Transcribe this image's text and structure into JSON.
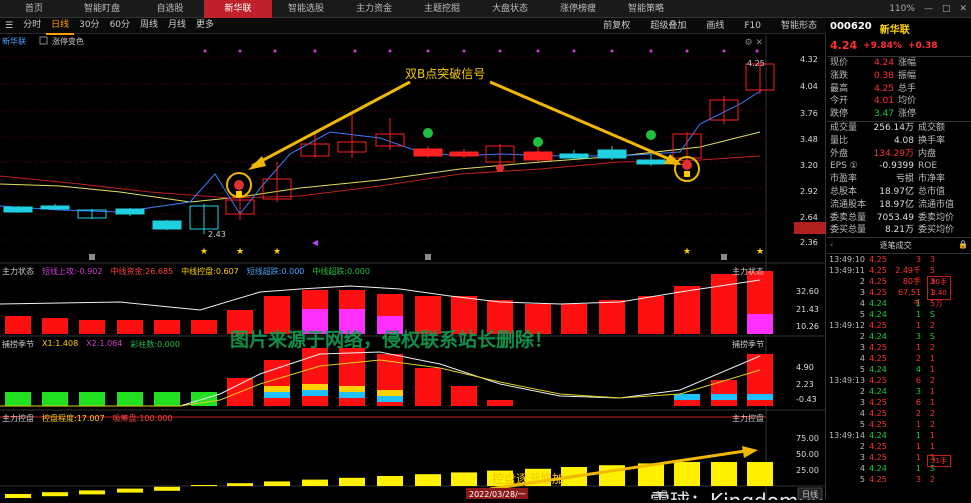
{
  "top_tabs": [
    "首页",
    "智能盯盘",
    "自选股",
    "新华联",
    "智能选股",
    "主力资金",
    "主题挖掘",
    "大盘状态",
    "涨停榜瘦",
    "智能策略"
  ],
  "active_tab": 3,
  "sys": {
    "signal": "",
    "battery": "110%",
    "minus": "—",
    "box": "□",
    "close": "✕"
  },
  "toolbar": {
    "left": [
      "分时",
      "日线",
      "30分",
      "60分",
      "周线",
      "月线",
      "更多"
    ],
    "active": 1,
    "right": [
      "前复权",
      "超级叠加",
      "画线",
      "F10",
      "智能形态"
    ]
  },
  "chart": {
    "stock_label": "新华联",
    "indicator_label": "涨停变色",
    "price_ticks": [
      "4.32",
      "4.04",
      "3.76",
      "3.48",
      "3.20",
      "2.92",
      "2.64",
      "2.51",
      "2.36"
    ],
    "high_label": "4.25",
    "low_label": "2.43",
    "annotation_top": "双B点突破信号",
    "panel1": {
      "name": "主力状态",
      "items": [
        "短线上攻:-0.902",
        "中线资金:26.685",
        "中线控盘:0.607",
        "短线超跌:0.000",
        "中线超跌:0.000"
      ],
      "ticks": [
        "32.60",
        "21.43",
        "10.26"
      ]
    },
    "panel2": {
      "name": "捕捞季节",
      "items": [
        "X1:1.408",
        "X2:1.064",
        "彩柱数:0.000"
      ],
      "ticks": [
        "4.90",
        "2.23",
        "-0.43"
      ]
    },
    "panel3": {
      "name": "主力控盘",
      "items": [
        "控盘程度:17.007",
        "吸筹盘:100.000"
      ],
      "ticks": [
        "75.00",
        "50.00",
        "25.00"
      ]
    },
    "annotation_bottom": "控盘逐渐增加",
    "watermark": "图片来源于网络，侵权联系站长删除！",
    "xueqiu": "雪球：Kingdom003",
    "date_label": "2022/03/28/一",
    "month_label": "4月",
    "period_btn": "日线"
  },
  "quote": {
    "code": "000620",
    "name": "新华联",
    "price": "4.24",
    "change_pct": "+9.84%",
    "change": "+0.38",
    "rows": [
      [
        "现价",
        "4.24",
        "涨幅",
        ""
      ],
      [
        "涨跌",
        "0.38",
        "振幅",
        ""
      ],
      [
        "最高",
        "4.25",
        "总手",
        ""
      ],
      [
        "今开",
        "4.01",
        "均价",
        ""
      ],
      [
        "跌停",
        "3.47",
        "涨停",
        ""
      ]
    ],
    "rows2": [
      [
        "成交量",
        "256.14万",
        "成交额"
      ],
      [
        "量比",
        "4.08",
        "换手率"
      ],
      [
        "外盘",
        "134.29万",
        "内盘"
      ],
      [
        "EPS ①",
        "-0.9399",
        "ROE"
      ],
      [
        "市盈率",
        "亏损",
        "市净率"
      ],
      [
        "总股本",
        "18.97亿",
        "总市值"
      ],
      [
        "流通股本",
        "18.97亿",
        "流通市值"
      ],
      [
        "委卖总量",
        "7053.49",
        "委卖均价"
      ],
      [
        "委买总量",
        "8.21万",
        "委买均价"
      ]
    ],
    "ticks_title": "逐笔成交",
    "ticks": [
      [
        "13:49:10",
        "4.25",
        "3",
        "3",
        ""
      ],
      [
        "13:49:11",
        "4.25",
        "2.49千",
        "5",
        ""
      ],
      [
        "2",
        "4.25",
        "80手",
        "3",
        ""
      ],
      [
        "3",
        "4.25",
        "67.51千",
        "1",
        ""
      ],
      [
        "4",
        "4.24",
        "1",
        "5",
        ""
      ],
      [
        "5",
        "4.24",
        "1",
        "S",
        ""
      ],
      [
        "13:49:12",
        "4.25",
        "1",
        "2",
        ""
      ],
      [
        "2",
        "4.24",
        "3",
        "S",
        ""
      ],
      [
        "3",
        "4.25",
        "1",
        "2",
        ""
      ],
      [
        "4",
        "4.25",
        "2",
        "1",
        ""
      ],
      [
        "5",
        "4.24",
        "4",
        "1",
        ""
      ],
      [
        "13:49:13",
        "4.25",
        "6",
        "2",
        ""
      ],
      [
        "2",
        "4.24",
        "3",
        "1",
        ""
      ],
      [
        "3",
        "4.25",
        "6",
        "1",
        ""
      ],
      [
        "4",
        "4.25",
        "2",
        "2",
        ""
      ],
      [
        "5",
        "4.25",
        "1",
        "2",
        ""
      ],
      [
        "13:49:14",
        "4.24",
        "1",
        "1",
        ""
      ],
      [
        "2",
        "4.25",
        "1",
        "1",
        ""
      ],
      [
        "3",
        "4.25",
        "1",
        "3",
        ""
      ],
      [
        "4",
        "4.24",
        "1",
        "S",
        ""
      ],
      [
        "5",
        "4.25",
        "3",
        "2",
        ""
      ]
    ],
    "big_order": "80手",
    "big_order2": "3.40万",
    "big_order3": "31手"
  }
}
